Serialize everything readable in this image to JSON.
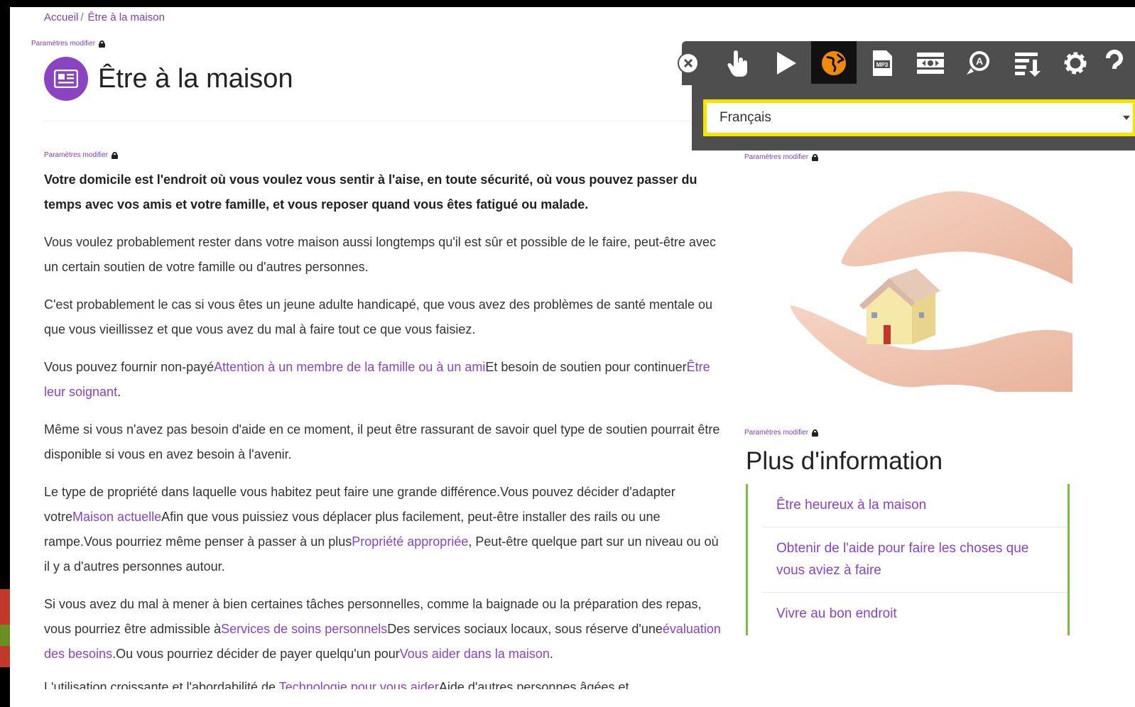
{
  "breadcrumb": {
    "home": "Accueil",
    "separator": "/",
    "current": "Être à la maison"
  },
  "params_label": "Paramètres modifier",
  "page": {
    "title": "Être à la maison",
    "icon": "newspaper-icon"
  },
  "content": {
    "lead": "Votre domicile est l'endroit où vous voulez vous sentir à l'aise, en toute sécurité, où vous pouvez passer du temps avec vos amis et votre famille, et vous reposer quand vous êtes fatigué ou malade.",
    "p1": "Vous voulez probablement rester dans votre maison aussi longtemps qu'il est sûr et possible de le faire, peut-être avec un certain soutien de votre famille ou d'autres personnes.",
    "p2": "C'est probablement le cas si vous êtes un jeune adulte handicapé, que vous avez des problèmes de santé mentale ou que vous vieillissez et que vous avez du mal à faire tout ce que vous faisiez.",
    "p3": {
      "t1": "Vous pouvez fournir non-payé",
      "l1": "Attention à un membre de la famille ou à un ami",
      "t2": "Et besoin de soutien pour continuer",
      "l2": "Être leur soignant",
      "t3": "."
    },
    "p4": "Même si vous n'avez pas besoin d'aide en ce moment, il peut être rassurant de savoir quel type de soutien pourrait être disponible si vous en avez besoin à l'avenir.",
    "p5": {
      "t1": "Le type de propriété dans laquelle vous habitez peut faire une grande différence.Vous pouvez décider d'adapter votre",
      "l1": "Maison actuelle",
      "t2": "Afin que vous puissiez vous déplacer plus facilement, peut-être installer des rails ou une rampe.Vous pourriez même penser à passer à un plus",
      "l2": "Propriété appropriée",
      "t3": ", Peut-être quelque part sur un niveau ou où il y a d'autres personnes autour."
    },
    "p6": {
      "t1": "Si vous avez du mal à mener à bien certaines tâches personnelles, comme la baignade ou la préparation des repas, vous pourriez être admissible à",
      "l1": "Services de soins personnels",
      "t2": "Des services sociaux locaux, sous réserve d'une",
      "l2": "évaluation des besoins",
      "t3": ".Ou vous pourriez décider de payer quelqu'un pour",
      "l3": "Vous aider dans la maison",
      "t4": "."
    },
    "p7": {
      "t1": "L'utilisation croissante et l'abordabilité de ",
      "l1": "Technologie pour vous aider",
      "t2": "Aide d'autres personnes âgées et"
    }
  },
  "sidebar": {
    "image_alt": "hands-protecting-house",
    "more_title": "Plus d'information",
    "links": [
      "Être heureux à la maison",
      "Obtenir de l'aide pour faire les choses que vous aviez à faire",
      "Vivre au bon endroit"
    ]
  },
  "toolbar": {
    "buttons": [
      "close-icon",
      "hand-pointer-icon",
      "play-icon",
      "globe-icon",
      "mp3-icon",
      "screen-mask-icon",
      "dictionary-icon",
      "reading-list-icon",
      "gear-icon",
      "help-icon"
    ],
    "language": "Français"
  },
  "colors": {
    "accent": "#8a44c2",
    "link": "#8a44c2",
    "list_border": "#7cbb45",
    "toolbar": "#4e4e4e",
    "highlight": "#f4e500",
    "globe": "#f08a0e"
  }
}
